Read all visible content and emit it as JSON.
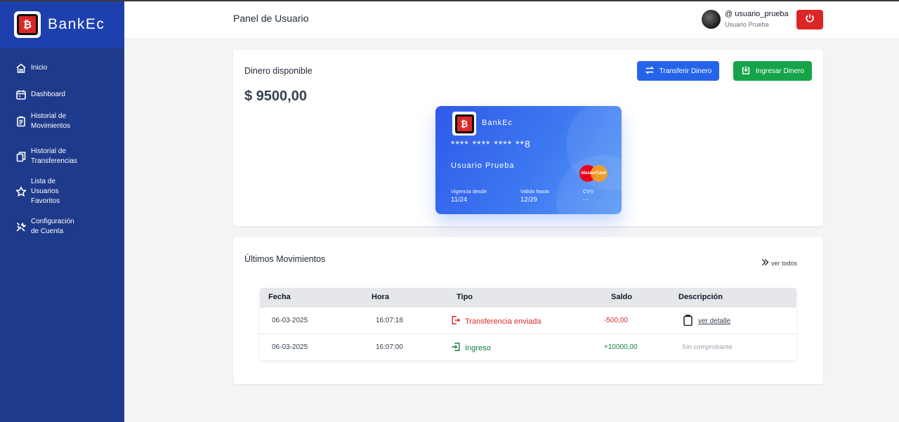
{
  "app": {
    "name": "BankEc"
  },
  "sidebar": {
    "items": [
      {
        "label": "Inicio",
        "icon": "home-icon"
      },
      {
        "label": "Dashboard",
        "icon": "calendar-icon"
      },
      {
        "label": "Historial de Movimientos",
        "icon": "clipboard-list-icon"
      },
      {
        "label": "Historial de Transferencias",
        "icon": "copy-icon"
      },
      {
        "label": "Lista de Usuarios Favoritos",
        "icon": "star-icon"
      },
      {
        "label": "Configuración de Cuenta",
        "icon": "tools-icon"
      }
    ]
  },
  "header": {
    "title": "Panel de Usuario",
    "user_handle": "@ usuario_prueba",
    "user_name": "Usuario Prueba",
    "logout_icon": "power-icon"
  },
  "balance": {
    "label": "Dinero disponible",
    "amount": "$ 9500,00",
    "transfer_button": "Transferir Dinero",
    "deposit_button": "Ingresar Dinero"
  },
  "card": {
    "brand": "BankEc",
    "number": "**** **** **** **8",
    "holder": "Usuario Prueba",
    "network": "MasterCard",
    "valid_from_label": "Vigencia desde",
    "valid_from": "11/24",
    "valid_thru_label": "Valido hasta",
    "valid_thru": "12/29",
    "cvv_label": "CVV",
    "cvv": "..."
  },
  "movements": {
    "title": "Últimos Movimientos",
    "see_all": "ver todos",
    "columns": [
      "Fecha",
      "Hora",
      "Tipo",
      "Saldo",
      "Descripción"
    ],
    "rows": [
      {
        "date": "06-03-2025",
        "time": "16:07:18",
        "type": "Transferencia enviada",
        "amount": "-500,00",
        "description": "ver detalle"
      },
      {
        "date": "06-03-2025",
        "time": "16:07:00",
        "type": "Ingreso",
        "amount": "+10000,00",
        "description": "Sin comprobante"
      }
    ]
  },
  "colors": {
    "sidebar": "#1e3a8a",
    "brand_bar": "#1e40af",
    "primary": "#2563eb",
    "success": "#16a34a",
    "danger": "#dc2626"
  }
}
